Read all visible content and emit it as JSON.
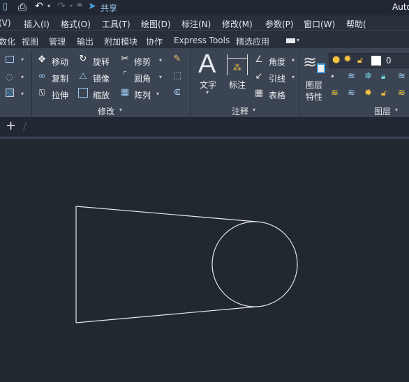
{
  "title_bar": {
    "share": "共享",
    "app_title": "Auto"
  },
  "menu": [
    "(V)",
    "插入(I)",
    "格式(O)",
    "工具(T)",
    "绘图(D)",
    "标注(N)",
    "修改(M)",
    "参数(P)",
    "窗口(W)",
    "帮助("
  ],
  "tabs": [
    "数化",
    "视图",
    "管理",
    "输出",
    "附加模块",
    "协作",
    "Express Tools",
    "精选应用"
  ],
  "modify": {
    "items": [
      "移动",
      "旋转",
      "修剪",
      "复制",
      "镜像",
      "圆角",
      "拉伸",
      "缩放",
      "阵列"
    ],
    "group": "修改"
  },
  "annotation": {
    "text": "文字",
    "dimension": "标注",
    "angle": "角度",
    "leader": "引线",
    "table": "表格",
    "group": "注释"
  },
  "layers": {
    "properties_1": "图层",
    "properties_2": "特性",
    "current": "0",
    "group": "图层"
  },
  "file_tab": {
    "new": "+",
    "sep": "/"
  },
  "colors": {
    "accent": "#4aa3e8",
    "canvas": "#212830",
    "ribbon": "#3b4452"
  }
}
